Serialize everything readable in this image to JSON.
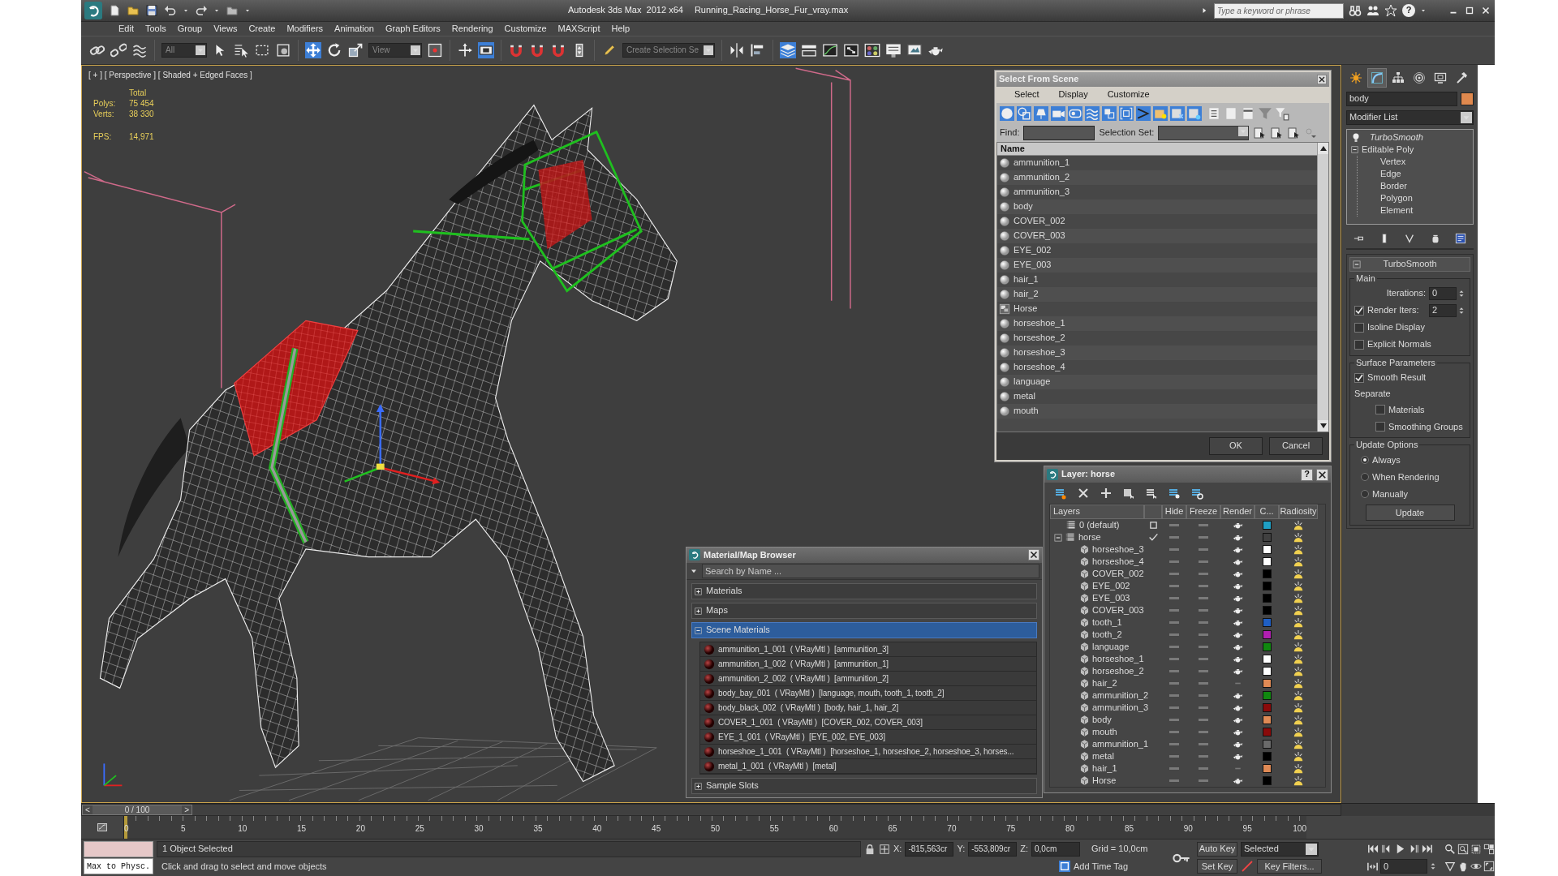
{
  "window": {
    "app_title": "Autodesk 3ds Max  2012 x64",
    "file_name": "Running_Racing_Horse_Fur_vray.max",
    "search_placeholder": "Type a keyword or phrase",
    "help": "?"
  },
  "menu": [
    "Edit",
    "Tools",
    "Group",
    "Views",
    "Create",
    "Modifiers",
    "Animation",
    "Graph Editors",
    "Rendering",
    "Customize",
    "MAXScript",
    "Help"
  ],
  "toolbar": {
    "selection_filter": "All",
    "reference_coord": "View",
    "named_selection": "Create Selection Se"
  },
  "viewport": {
    "label": "[ + ] [ Perspective ] [ Shaded + Edged Faces ]",
    "stats_heading": "Total",
    "polys_label": "Polys:",
    "polys": "75 454",
    "verts_label": "Verts:",
    "verts": "38 330",
    "fps_label": "FPS:",
    "fps": "14,971"
  },
  "select_from_scene": {
    "title": "Select From Scene",
    "menus": [
      "Select",
      "Display",
      "Customize"
    ],
    "find_label": "Find:",
    "selection_set_label": "Selection Set:",
    "column": "Name",
    "items": [
      {
        "name": "ammunition_1",
        "kind": "geometry"
      },
      {
        "name": "ammunition_2",
        "kind": "geometry"
      },
      {
        "name": "ammunition_3",
        "kind": "geometry"
      },
      {
        "name": "body",
        "kind": "geometry"
      },
      {
        "name": "COVER_002",
        "kind": "geometry"
      },
      {
        "name": "COVER_003",
        "kind": "geometry"
      },
      {
        "name": "EYE_002",
        "kind": "geometry"
      },
      {
        "name": "EYE_003",
        "kind": "geometry"
      },
      {
        "name": "hair_1",
        "kind": "geometry"
      },
      {
        "name": "hair_2",
        "kind": "geometry"
      },
      {
        "name": "Horse",
        "kind": "group"
      },
      {
        "name": "horseshoe_1",
        "kind": "geometry"
      },
      {
        "name": "horseshoe_2",
        "kind": "geometry"
      },
      {
        "name": "horseshoe_3",
        "kind": "geometry"
      },
      {
        "name": "horseshoe_4",
        "kind": "geometry"
      },
      {
        "name": "language",
        "kind": "geometry"
      },
      {
        "name": "metal",
        "kind": "geometry"
      },
      {
        "name": "mouth",
        "kind": "geometry"
      }
    ],
    "buttons": [
      "OK",
      "Cancel"
    ]
  },
  "layer_manager": {
    "title": "Layer: horse",
    "help": "?",
    "columns": [
      "Layers",
      "Hide",
      "Freeze",
      "Render",
      "C...",
      "Radiosity"
    ],
    "layers": [
      {
        "name": "0 (default)",
        "current": false,
        "color": "#1f9fc4",
        "render": true
      },
      {
        "name": "horse",
        "current": true,
        "expanded": true,
        "color": "#404040",
        "render": true,
        "children": [
          {
            "name": "horseshoe_3",
            "color": "#ffffff",
            "render": true
          },
          {
            "name": "horseshoe_4",
            "color": "#ffffff",
            "render": true
          },
          {
            "name": "COVER_002",
            "color": "#000000",
            "render": true
          },
          {
            "name": "EYE_002",
            "color": "#000000",
            "render": true
          },
          {
            "name": "EYE_003",
            "color": "#000000",
            "render": true
          },
          {
            "name": "COVER_003",
            "color": "#000000",
            "render": true
          },
          {
            "name": "tooth_1",
            "color": "#1f5fc4",
            "render": true
          },
          {
            "name": "tooth_2",
            "color": "#b01fb0",
            "render": true
          },
          {
            "name": "language",
            "color": "#10880f",
            "render": true
          },
          {
            "name": "horseshoe_1",
            "color": "#ffffff",
            "render": true
          },
          {
            "name": "horseshoe_2",
            "color": "#ffffff",
            "render": true
          },
          {
            "name": "hair_2",
            "color": "#e08a55",
            "render": false
          },
          {
            "name": "ammunition_2",
            "color": "#10880f",
            "render": true
          },
          {
            "name": "ammunition_3",
            "color": "#8a0a0a",
            "render": true
          },
          {
            "name": "body",
            "color": "#e08a55",
            "render": true
          },
          {
            "name": "mouth",
            "color": "#8a0a0a",
            "render": true
          },
          {
            "name": "ammunition_1",
            "color": "#6a6a6a",
            "render": true
          },
          {
            "name": "metal",
            "color": "#000000",
            "render": true
          },
          {
            "name": "hair_1",
            "color": "#e08a55",
            "render": false
          },
          {
            "name": "Horse",
            "color": "#000000",
            "render": true
          }
        ]
      }
    ]
  },
  "material_browser": {
    "title": "Material/Map Browser",
    "search_placeholder": "Search by Name ...",
    "groups": [
      {
        "label": "Materials",
        "expanded": false,
        "selected": false
      },
      {
        "label": "Maps",
        "expanded": false,
        "selected": false
      },
      {
        "label": "Scene Materials",
        "expanded": true,
        "selected": true,
        "items": [
          "ammunition_1_001  ( VRayMtl )  [ammunition_3]",
          "ammunition_1_002  ( VRayMtl )  [ammunition_1]",
          "ammunition_2_002  ( VRayMtl )  [ammunition_2]",
          "body_bay_001  ( VRayMtl )  [language, mouth, tooth_1, tooth_2]",
          "body_black_002  ( VRayMtl )  [body, hair_1, hair_2]",
          "COVER_1_001  ( VRayMtl )  [COVER_002, COVER_003]",
          "EYE_1_001  ( VRayMtl )  [EYE_002, EYE_003]",
          "horseshoe_1_001  ( VRayMtl )  [horseshoe_1, horseshoe_2, horseshoe_3, horses...",
          "metal_1_001  ( VRayMtl )  [metal]"
        ]
      },
      {
        "label": "Sample Slots",
        "expanded": false,
        "selected": false
      }
    ]
  },
  "command_panel": {
    "tabs": [
      {
        "selected": false
      },
      {
        "selected": true
      },
      {
        "selected": false
      },
      {
        "selected": false
      },
      {
        "selected": false
      },
      {
        "selected": false
      }
    ],
    "object_name": "body",
    "modifier_list": "Modifier List",
    "stack": [
      {
        "name": "TurboSmooth",
        "kind": "modifier"
      },
      {
        "name": "Editable Poly",
        "kind": "base",
        "expanded": true,
        "children": [
          {
            "name": "Vertex"
          },
          {
            "name": "Edge"
          },
          {
            "name": "Border"
          },
          {
            "name": "Polygon"
          },
          {
            "name": "Element"
          }
        ]
      }
    ],
    "rollout": {
      "title": "TurboSmooth",
      "expanded": true,
      "main_label": "Main",
      "iterations_label": "Iterations:",
      "iterations": "0",
      "render_iters": {
        "label": "Render Iters:",
        "checked": true,
        "value": "2"
      },
      "isoline_display": {
        "label": "Isoline Display",
        "checked": false
      },
      "explicit_normals": {
        "label": "Explicit Normals",
        "checked": false
      },
      "surface_label": "Surface Parameters",
      "smooth_result": {
        "label": "Smooth Result",
        "checked": true
      },
      "separate_label": "Separate",
      "materials": {
        "label": "Materials",
        "checked": false
      },
      "smoothing_groups": {
        "label": "Smoothing Groups",
        "checked": false
      },
      "update_label": "Update Options",
      "update_options": [
        {
          "label": "Always",
          "selected": true
        },
        {
          "label": "When Rendering",
          "selected": false
        },
        {
          "label": "Manually",
          "selected": false
        }
      ],
      "update_button": "Update"
    }
  },
  "timeline": {
    "prev": "<",
    "frame": "0 / 100",
    "next": ">",
    "level": 0,
    "ticks": [
      "0",
      "5",
      "10",
      "15",
      "20",
      "25",
      "30",
      "35",
      "40",
      "45",
      "50",
      "55",
      "60",
      "65",
      "70",
      "75",
      "80",
      "85",
      "90",
      "95",
      "100"
    ]
  },
  "status": {
    "listener": "Max to Physc.",
    "selection": "1 Object Selected",
    "prompt": "Click and drag to select and move objects",
    "x_label": "X:",
    "x": "-815,563cr",
    "y_label": "Y:",
    "y": "-553,809cr",
    "z_label": "Z:",
    "z": "0,0cm",
    "grid": "Grid = 10,0cm",
    "time_tag": "Add Time Tag",
    "auto_key": "Auto Key",
    "set_key": "Set Key",
    "key_mode": "Selected",
    "key_filters": "Key Filters...",
    "current_frame": "0"
  }
}
